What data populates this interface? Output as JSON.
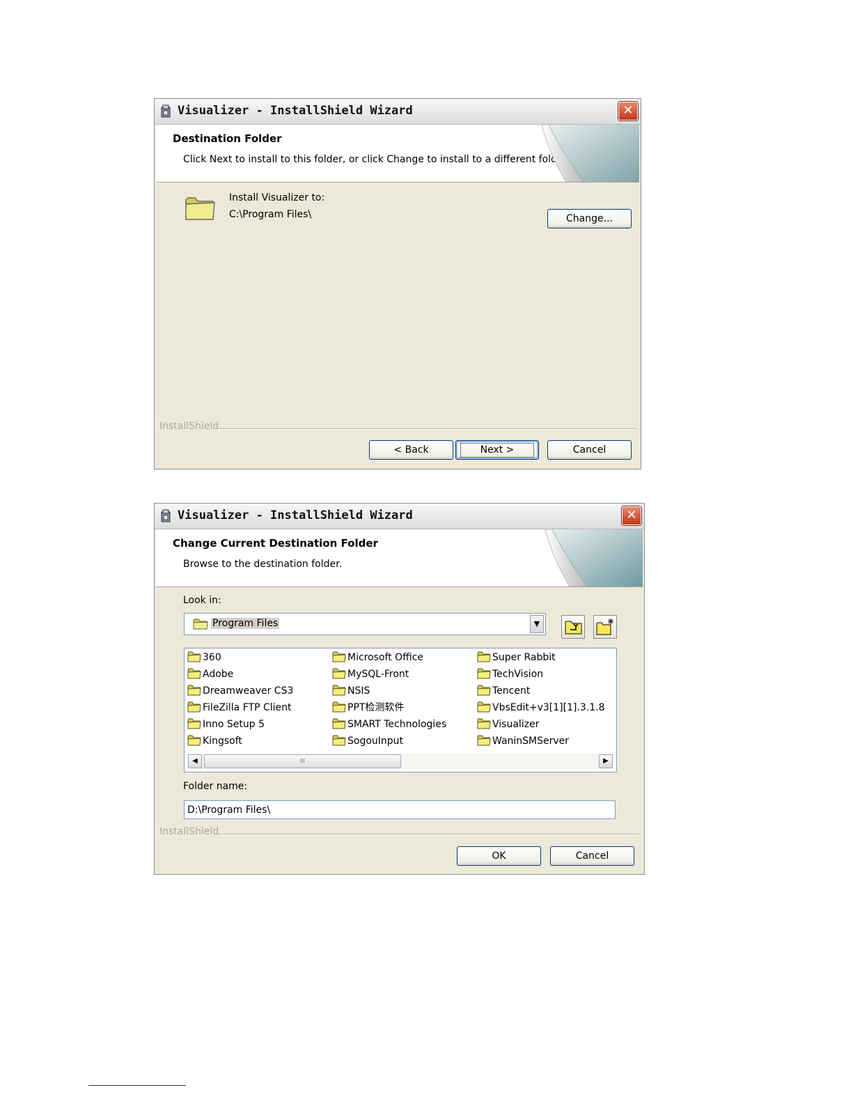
{
  "dialog1": {
    "title": "Visualizer - InstallShield Wizard",
    "close": "✕",
    "header_title": "Destination Folder",
    "header_desc": "Click Next to install to this folder, or click Change to install to a different folder.",
    "install_to_label": "Install Visualizer to:",
    "install_path": "C:\\Program Files\\",
    "change_button": "Change...",
    "brand": "InstallShield",
    "back_button": "< Back",
    "next_button": "Next >",
    "cancel_button": "Cancel"
  },
  "dialog2": {
    "title": "Visualizer - InstallShield Wizard",
    "close": "✕",
    "header_title": "Change Current Destination Folder",
    "header_desc": "Browse to the destination folder.",
    "look_in_label": "Look in:",
    "look_in_value": "Program Files",
    "folders": [
      [
        "360",
        "Adobe",
        "Dreamweaver CS3",
        "FileZilla FTP Client",
        "Inno Setup 5",
        "Kingsoft"
      ],
      [
        "Microsoft Office",
        "MySQL-Front",
        "NSIS",
        "PPT检测软件",
        "SMART Technologies",
        "SogouInput"
      ],
      [
        "Super Rabbit",
        "TechVision",
        "Tencent",
        "VbsEdit+v3[1][1].3.1.8",
        "Visualizer",
        "WaninSMServer"
      ]
    ],
    "scroll_left": "◀",
    "scroll_right": "▶",
    "thumb_grip": "III",
    "combo_arrow": "▼",
    "folder_name_label": "Folder name:",
    "folder_name_value": "D:\\Program Files\\",
    "brand": "InstallShield",
    "ok_button": "OK",
    "cancel_button": "Cancel"
  }
}
